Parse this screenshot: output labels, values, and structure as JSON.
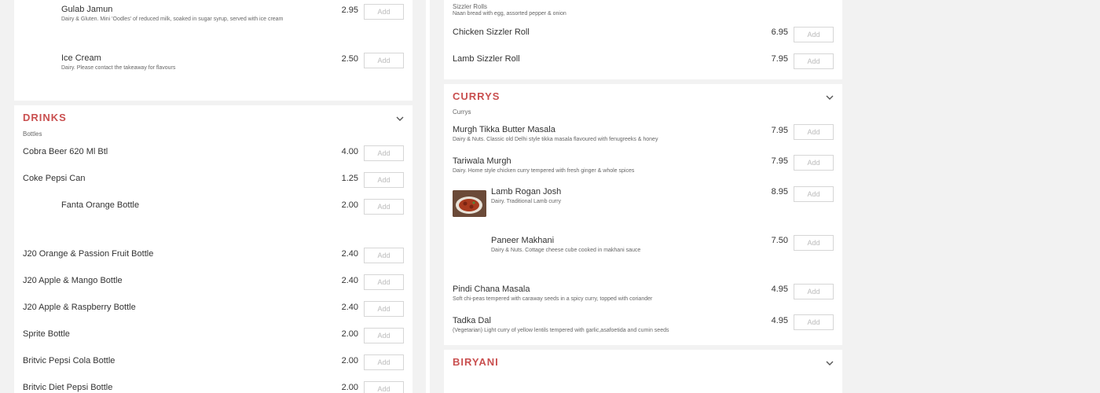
{
  "left": {
    "desserts": [
      {
        "name": "Gulab Jamun",
        "desc": "Dairy & Gluten. Mini 'Oodles' of reduced milk, soaked in sugar syrup, served with ice cream",
        "price": "2.95"
      },
      {
        "name": "Ice Cream",
        "desc": "Dairy. Please contact the takeaway for flavours",
        "price": "2.50"
      }
    ],
    "drinks": {
      "title": "DRINKS",
      "subtitle": "Bottles",
      "items": [
        {
          "name": "Cobra Beer 620 Ml Btl",
          "price": "4.00"
        },
        {
          "name": "Coke Pepsi Can",
          "price": "1.25"
        },
        {
          "name": "Fanta Orange Bottle",
          "price": "2.00"
        },
        {
          "name": "J20 Orange & Passion Fruit Bottle",
          "price": "2.40"
        },
        {
          "name": "J20 Apple & Mango Bottle",
          "price": "2.40"
        },
        {
          "name": "J20 Apple & Raspberry Bottle",
          "price": "2.40"
        },
        {
          "name": "Sprite Bottle",
          "price": "2.00"
        },
        {
          "name": "Britvic Pepsi Cola Bottle",
          "price": "2.00"
        },
        {
          "name": "Britvic Diet Pepsi Bottle",
          "price": "2.00"
        }
      ]
    }
  },
  "right": {
    "sizzler": {
      "subtitle": "Sizzler Rolls",
      "desc": "Naan bread with egg, assorted pepper & onion",
      "items": [
        {
          "name": "Chicken Sizzler Roll",
          "price": "6.95"
        },
        {
          "name": "Lamb Sizzler Roll",
          "price": "7.95"
        }
      ]
    },
    "currys": {
      "title": "CURRYS",
      "subtitle": "Currys",
      "items": [
        {
          "name": "Murgh Tikka Butter Masala",
          "desc": "Dairy & Nuts. Classic old Delhi style tikka masala flavoured with fenugreeks & honey",
          "price": "7.95"
        },
        {
          "name": "Tariwala Murgh",
          "desc": "Dairy. Home style chicken curry tempered with fresh ginger & whole spices",
          "price": "7.95"
        },
        {
          "name": "Lamb Rogan Josh",
          "desc": "Dairy. Traditional Lamb curry",
          "price": "8.95"
        },
        {
          "name": "Paneer Makhani",
          "desc": "Dairy & Nuts. Cottage cheese cube cooked in makhani sauce",
          "price": "7.50"
        },
        {
          "name": "Pindi Chana Masala",
          "desc": "Soft chi-peas tempered with caraway seeds in a spicy curry, topped with coriander",
          "price": "4.95"
        },
        {
          "name": "Tadka Dal",
          "desc": "(Vegetarian) Light curry of yellow lentils tempered with garlic,asafoetida and cumin seeds",
          "price": "4.95"
        }
      ]
    },
    "biryani": {
      "title": "BIRYANI"
    }
  },
  "ui": {
    "add_label": "Add",
    "accent": "#c94f4f",
    "chevron_icon": "chevron-down-icon"
  }
}
